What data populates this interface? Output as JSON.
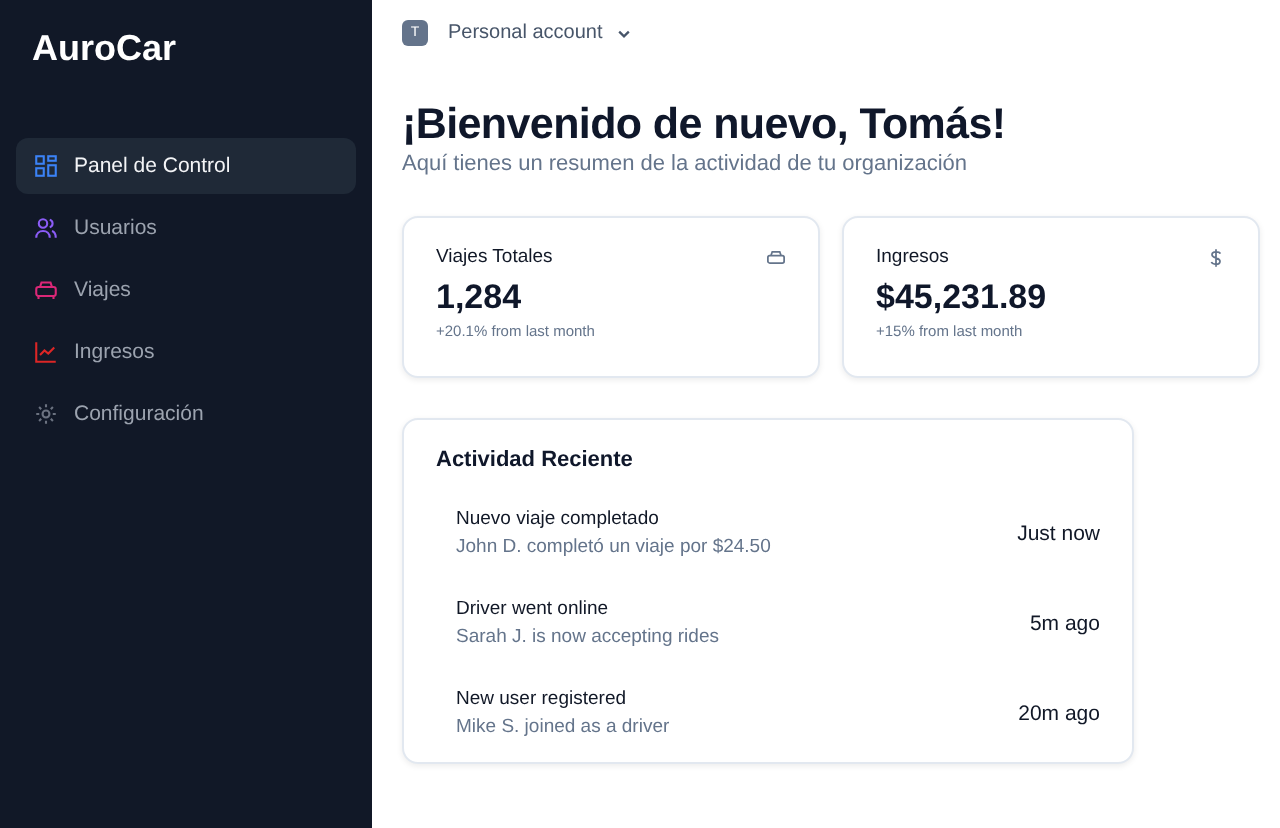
{
  "sidebar": {
    "brand": "AuroCar",
    "items": [
      {
        "label": "Panel de Control",
        "kind": "grid",
        "color": "#3b82f6",
        "selected": true
      },
      {
        "label": "Usuarios",
        "kind": "users",
        "color": "#8b5cf6",
        "selected": false
      },
      {
        "label": "Viajes",
        "kind": "car",
        "color": "#db2777",
        "selected": false
      },
      {
        "label": "Ingresos",
        "kind": "chart",
        "color": "#dc2626",
        "selected": false
      },
      {
        "label": "Configuración",
        "kind": "gear",
        "color": "#6b7280",
        "selected": false
      }
    ]
  },
  "account": {
    "initial": "T",
    "label": "Personal account"
  },
  "heading": "¡Bienvenido de nuevo, Tomás!",
  "subheading": "Aquí tienes un resumen de la actividad de tu organización",
  "stats": [
    {
      "title": "Viajes Totales",
      "kind": "car",
      "value": "1,284",
      "change": "+20.1% from last month"
    },
    {
      "title": "Ingresos",
      "kind": "dollar",
      "value": "$45,231.89",
      "change": "+15% from last month"
    }
  ],
  "activity": {
    "title": "Actividad Reciente",
    "items": [
      {
        "title": "Nuevo viaje completado",
        "detail": "John D. completó un viaje por $24.50",
        "time": "Just now"
      },
      {
        "title": "Driver went online",
        "detail": "Sarah J. is now accepting rides",
        "time": "5m ago"
      },
      {
        "title": "New user registered",
        "detail": "Mike S. joined as a driver",
        "time": "20m ago"
      }
    ]
  }
}
